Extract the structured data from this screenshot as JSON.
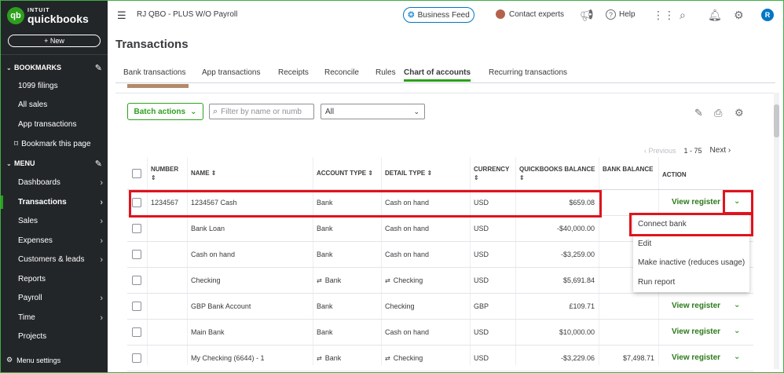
{
  "app": {
    "logo_top": "INTUIT",
    "logo_bottom": "quickbooks",
    "logo_badge": "qb",
    "new_label": "+ New",
    "company": "RJ QBO - PLUS W/O Payroll",
    "business_feed": "Business Feed",
    "contact_experts": "Contact experts",
    "help": "Help",
    "user_initial": "R"
  },
  "sidebar": {
    "bookmarks_header": "BOOKMARKS",
    "bookmarks": [
      "1099 filings",
      "All sales",
      "App transactions",
      "Bookmark this page"
    ],
    "menu_header": "MENU",
    "menu": [
      {
        "label": "Dashboards",
        "arrow": true
      },
      {
        "label": "Transactions",
        "arrow": true,
        "active": true
      },
      {
        "label": "Sales",
        "arrow": true
      },
      {
        "label": "Expenses",
        "arrow": true
      },
      {
        "label": "Customers & leads",
        "arrow": true
      },
      {
        "label": "Reports",
        "arrow": false
      },
      {
        "label": "Payroll",
        "arrow": true
      },
      {
        "label": "Time",
        "arrow": true
      },
      {
        "label": "Projects",
        "arrow": false
      }
    ],
    "menu_settings": "Menu settings"
  },
  "page": {
    "title": "Transactions",
    "tabs": [
      "Bank transactions",
      "App transactions",
      "Receipts",
      "Reconcile",
      "Rules",
      "Chart of accounts",
      "Recurring transactions"
    ],
    "active_tab": "Chart of accounts"
  },
  "toolbar": {
    "batch_actions": "Batch actions",
    "filter_placeholder": "Filter by name or numb",
    "type_select": "All"
  },
  "pager": {
    "previous": "Previous",
    "range": "1 - 75",
    "next": "Next"
  },
  "table": {
    "headers": {
      "number": "NUMBER",
      "name": "NAME",
      "account_type": "ACCOUNT TYPE",
      "detail_type": "DETAIL TYPE",
      "currency": "CURRENCY",
      "qb_balance": "QUICKBOOKS BALANCE",
      "bank_balance": "BANK BALANCE",
      "action": "ACTION"
    },
    "rows": [
      {
        "number": "1234567",
        "name": "1234567 Cash",
        "account_type": "Bank",
        "detail_type": "Cash on hand",
        "currency": "USD",
        "qb_balance": "$659.08",
        "bank_balance": "",
        "action": "View register",
        "linked": false
      },
      {
        "number": "",
        "name": "Bank Loan",
        "account_type": "Bank",
        "detail_type": "Cash on hand",
        "currency": "USD",
        "qb_balance": "-$40,000.00",
        "bank_balance": "",
        "action": "",
        "linked": false
      },
      {
        "number": "",
        "name": "Cash on hand",
        "account_type": "Bank",
        "detail_type": "Cash on hand",
        "currency": "USD",
        "qb_balance": "-$3,259.00",
        "bank_balance": "",
        "action": "",
        "linked": false
      },
      {
        "number": "",
        "name": "Checking",
        "account_type": "Bank",
        "detail_type": "Checking",
        "currency": "USD",
        "qb_balance": "$5,691.84",
        "bank_balance": "",
        "action": "",
        "linked": true
      },
      {
        "number": "",
        "name": "GBP Bank Account",
        "account_type": "Bank",
        "detail_type": "Checking",
        "currency": "GBP",
        "qb_balance": "£109.71",
        "bank_balance": "",
        "action": "View register",
        "linked": false
      },
      {
        "number": "",
        "name": "Main Bank",
        "account_type": "Bank",
        "detail_type": "Cash on hand",
        "currency": "USD",
        "qb_balance": "$10,000.00",
        "bank_balance": "",
        "action": "View register",
        "linked": false
      },
      {
        "number": "",
        "name": "My Checking (6644) - 1",
        "account_type": "Bank",
        "detail_type": "Checking",
        "currency": "USD",
        "qb_balance": "-$3,229.06",
        "bank_balance": "$7,498.71",
        "action": "View register",
        "linked": true
      }
    ]
  },
  "dropdown": {
    "items": [
      "Connect bank",
      "Edit",
      "Make inactive (reduces usage)",
      "Run report"
    ]
  },
  "colors": {
    "sidebar_bg": "#232629",
    "brand_green": "#2ca01c",
    "link_blue": "#0077c5",
    "highlight_red": "#e0131d"
  }
}
